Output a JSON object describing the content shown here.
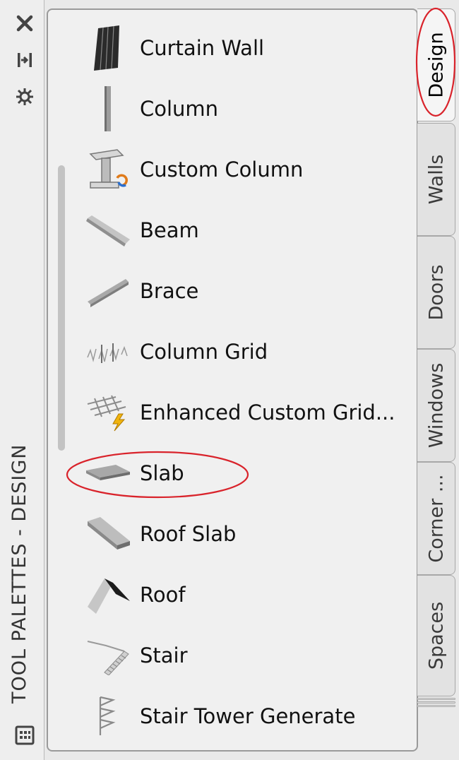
{
  "palette": {
    "title": "TOOL PALETTES - DESIGN"
  },
  "strip_icons": [
    "close-icon",
    "auto-hide-icon",
    "properties-icon",
    "palette-menu-icon"
  ],
  "tools": [
    {
      "label": "Curtain Wall",
      "icon": "curtain-wall-icon"
    },
    {
      "label": "Column",
      "icon": "column-icon"
    },
    {
      "label": "Custom Column",
      "icon": "custom-column-icon"
    },
    {
      "label": "Beam",
      "icon": "beam-icon"
    },
    {
      "label": "Brace",
      "icon": "brace-icon"
    },
    {
      "label": "Column Grid",
      "icon": "column-grid-icon"
    },
    {
      "label": "Enhanced  Custom  Grid...",
      "icon": "enhanced-custom-grid-icon"
    },
    {
      "label": "Slab",
      "icon": "slab-icon",
      "annotated": true
    },
    {
      "label": "Roof Slab",
      "icon": "roof-slab-icon"
    },
    {
      "label": "Roof",
      "icon": "roof-icon"
    },
    {
      "label": "Stair",
      "icon": "stair-icon"
    },
    {
      "label": "Stair Tower Generate",
      "icon": "stair-tower-generate-icon"
    }
  ],
  "tabs": [
    {
      "label": "Design",
      "active": true,
      "annotated": true
    },
    {
      "label": "Walls",
      "active": false
    },
    {
      "label": "Doors",
      "active": false
    },
    {
      "label": "Windows",
      "active": false
    },
    {
      "label": "Corner ...",
      "active": false
    },
    {
      "label": "Spaces",
      "active": false
    }
  ],
  "colors": {
    "annotation": "#d9232b",
    "panel_bg": "#f0f0f0",
    "tab_bg": "#e2e2e2"
  }
}
